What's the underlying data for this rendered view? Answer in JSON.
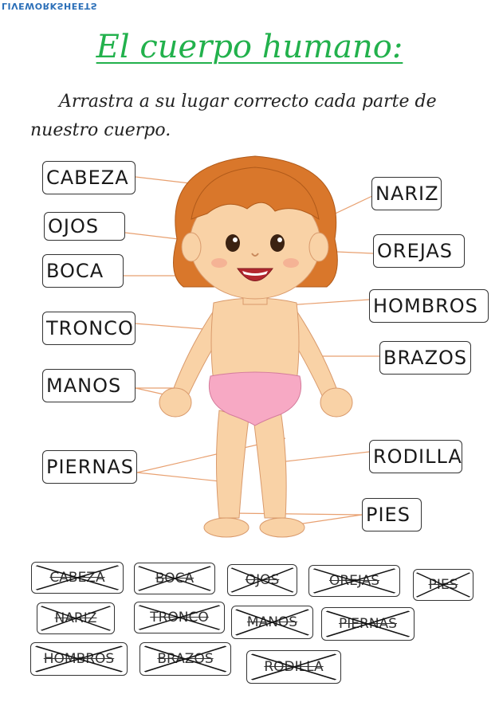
{
  "brand": "LIVEWORKSHEETS",
  "title": "El cuerpo humano:",
  "instruction": "Arrastra a su lugar correcto cada parte de nuestro cuerpo.",
  "labels": {
    "cabeza": "CABEZA",
    "ojos": "OJOS",
    "boca": "BOCA",
    "tronco": "TRONCO",
    "manos": "MANOS",
    "piernas": "PIERNAS",
    "nariz": "NARIZ",
    "orejas": "OREJAS",
    "hombros": "HOMBROS",
    "brazos": "BRAZOS",
    "rodilla": "RODILLA",
    "pies": "PIES"
  },
  "bank": [
    "CABEZA",
    "BOCA",
    "OJOS",
    "OREJAS",
    "PIES",
    "NARIZ",
    "TRONCO",
    "MANOS",
    "PIERNAS",
    "HOMBROS",
    "BRAZOS",
    "RODILLA"
  ],
  "colors": {
    "title": "#22b14c",
    "hair": "#d9772b",
    "skin": "#f9d2a6",
    "underwear": "#f7a9c4",
    "line": "#e8a070"
  }
}
